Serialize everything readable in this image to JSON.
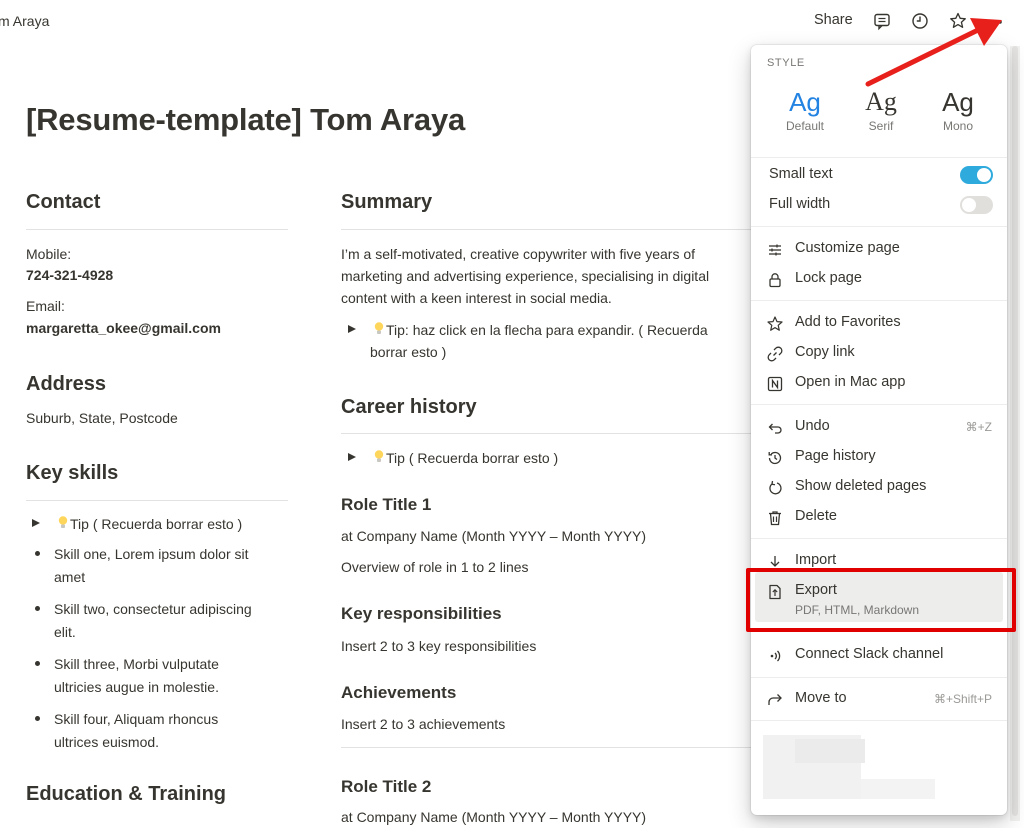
{
  "topbar": {
    "breadcrumb": "m Araya",
    "share_label": "Share",
    "icons": [
      "comment-icon",
      "clock-icon",
      "star-icon",
      "more-icon"
    ]
  },
  "page": {
    "title": "[Resume-template] Tom Araya"
  },
  "left": {
    "contact_heading": "Contact",
    "mobile_label": "Mobile:",
    "mobile_value": "724-321-4928",
    "email_label": "Email:",
    "email_value": "margaretta_okee@gmail.com",
    "address_heading": "Address",
    "address_value": "Suburb, State, Postcode",
    "skills_heading": "Key skills",
    "skills_tip": "Tip ( Recuerda borrar esto )",
    "skills": [
      [
        "Skill one, Lorem ipsum dolor sit",
        "amet"
      ],
      [
        "Skill two, consectetur adipiscing",
        "elit."
      ],
      [
        "Skill three, Morbi vulputate",
        "ultricies augue in molestie."
      ],
      [
        "Skill four, Aliquam rhoncus",
        "ultrices euismod."
      ]
    ],
    "education_heading": "Education & Training"
  },
  "mid": {
    "summary_heading": "Summary",
    "summary_lines": [
      "I’m a self-motivated, creative copywriter with five years of",
      "marketing and advertising experience, specialising in digital",
      "content with a keen interest in social media."
    ],
    "summary_tip_lines": [
      "Tip: haz click en la flecha para expandir. ( Recuerda",
      "borrar esto )"
    ],
    "career_heading": "Career history",
    "career_tip": "Tip ( Recuerda borrar esto )",
    "role1_title": "Role Title 1",
    "role1_company": "at Company Name (Month YYYY – Month YYYY)",
    "role1_overview": "Overview of role in 1 to 2 lines",
    "resp_heading": "Key responsibilities",
    "resp_text": "Insert 2 to 3 key responsibilities",
    "ach_heading": "Achievements",
    "ach_text": "Insert 2 to 3 achievements",
    "role2_title": "Role Title 2",
    "role2_company": "at Company Name (Month YYYY – Month YYYY)"
  },
  "menu": {
    "style_label": "STYLE",
    "styles": [
      {
        "glyph": "Ag",
        "label": "Default",
        "selected": true
      },
      {
        "glyph": "Ag",
        "label": "Serif",
        "selected": false
      },
      {
        "glyph": "Ag",
        "label": "Mono",
        "selected": false
      }
    ],
    "small_text_label": "Small text",
    "small_text_on": true,
    "full_width_label": "Full width",
    "full_width_on": false,
    "customize_label": "Customize page",
    "lock_label": "Lock page",
    "favorites_label": "Add to Favorites",
    "copy_link_label": "Copy link",
    "open_mac_label": "Open in Mac app",
    "undo_label": "Undo",
    "undo_shortcut": "⌘+Z",
    "history_label": "Page history",
    "deleted_label": "Show deleted pages",
    "delete_label": "Delete",
    "import_label": "Import",
    "export_label": "Export",
    "export_sub": "PDF, HTML, Markdown",
    "slack_label": "Connect Slack channel",
    "move_label": "Move to",
    "move_shortcut": "⌘+Shift+P"
  },
  "colors": {
    "accent": "#2383e2",
    "toggle_on": "#2eaadc",
    "highlight_red": "#e00000",
    "arrow_red": "#e8201c"
  }
}
